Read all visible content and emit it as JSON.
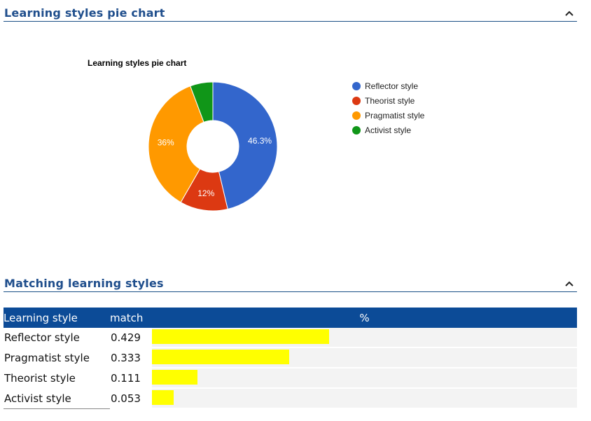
{
  "sections": {
    "pie": {
      "title": "Learning styles pie chart"
    },
    "matching": {
      "title": "Matching learning styles"
    }
  },
  "chart_data": {
    "type": "pie",
    "title": "Learning styles pie chart",
    "donut": true,
    "legend_position": "right",
    "slices": [
      {
        "name": "Reflector style",
        "value": 46.3,
        "label": "46.3%",
        "color": "#3366cc"
      },
      {
        "name": "Theorist style",
        "value": 12,
        "label": "12%",
        "color": "#dc3912"
      },
      {
        "name": "Pragmatist style",
        "value": 36,
        "label": "36%",
        "color": "#ff9900"
      },
      {
        "name": "Activist style",
        "value": 5.7,
        "label": "",
        "color": "#109618"
      }
    ]
  },
  "table": {
    "headers": {
      "style": "Learning style",
      "match": "match",
      "percent": "%"
    },
    "bar_color": "#ffff00",
    "rows": [
      {
        "style": "Reflector style",
        "match": "0.429",
        "value": 0.429
      },
      {
        "style": "Pragmatist style",
        "match": "0.333",
        "value": 0.333
      },
      {
        "style": "Theorist style",
        "match": "0.111",
        "value": 0.111
      },
      {
        "style": "Activist style",
        "match": "0.053",
        "value": 0.053
      }
    ]
  }
}
